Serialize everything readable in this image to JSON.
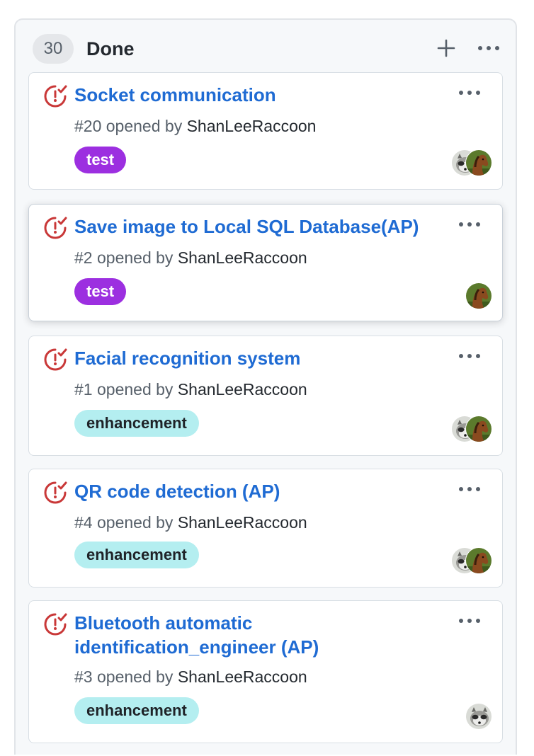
{
  "column": {
    "count": "30",
    "title": "Done",
    "add_icon": "plus-icon",
    "more_icon": "kebab-horizontal-icon"
  },
  "colors": {
    "link": "#1f6bd3",
    "issue_closed_icon": "#c93838",
    "label_test": "#9c2fe0",
    "label_enhancement": "#b4eef0",
    "column_bg": "#f6f8fa"
  },
  "cards": [
    {
      "title": "Socket communication",
      "number": "#20",
      "opened_by": "opened by",
      "author": "ShanLeeRaccoon",
      "label": "test",
      "avatars": [
        "raccoon-avatar",
        "horse-avatar"
      ]
    },
    {
      "title": "Save image to Local SQL Database(AP)",
      "number": "#2",
      "opened_by": "opened by",
      "author": "ShanLeeRaccoon",
      "label": "test",
      "avatars": [
        "horse-avatar"
      ]
    },
    {
      "title": "Facial recognition system",
      "number": "#1",
      "opened_by": "opened by",
      "author": "ShanLeeRaccoon",
      "label": "enhancement",
      "avatars": [
        "raccoon-avatar",
        "horse-avatar"
      ]
    },
    {
      "title": "QR code detection (AP)",
      "number": "#4",
      "opened_by": "opened by",
      "author": "ShanLeeRaccoon",
      "label": "enhancement",
      "avatars": [
        "raccoon-avatar",
        "horse-avatar"
      ]
    },
    {
      "title": "Bluetooth automatic identification_engineer (AP)",
      "number": "#3",
      "opened_by": "opened by",
      "author": "ShanLeeRaccoon",
      "label": "enhancement",
      "avatars": [
        "raccoon-avatar"
      ]
    }
  ]
}
